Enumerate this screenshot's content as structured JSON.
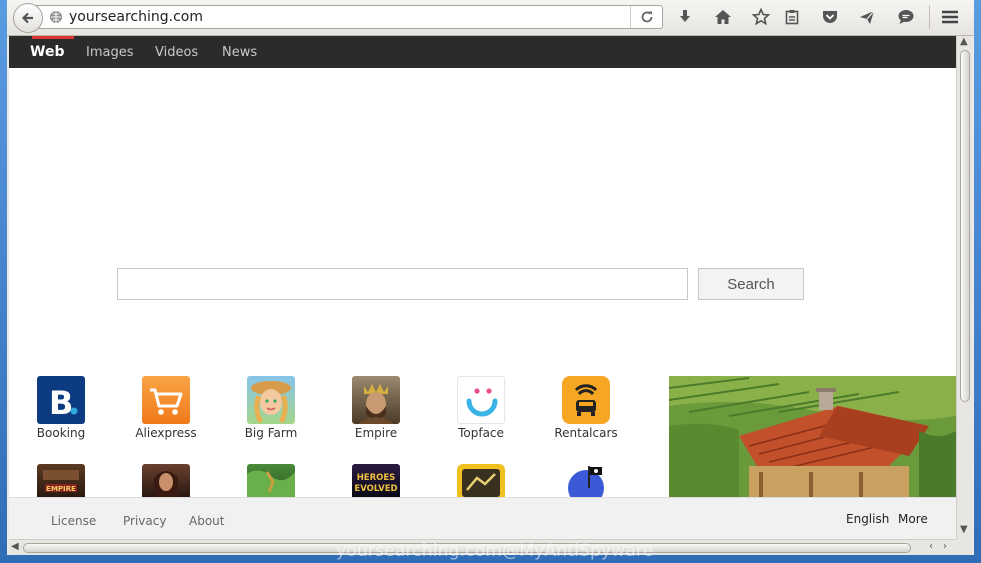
{
  "browser": {
    "url": "yoursearching.com"
  },
  "nav": {
    "items": [
      {
        "label": "Web",
        "active": true
      },
      {
        "label": "Images",
        "active": false
      },
      {
        "label": "Videos",
        "active": false
      },
      {
        "label": "News",
        "active": false
      }
    ]
  },
  "search": {
    "value": "",
    "button_label": "Search"
  },
  "tiles": {
    "row1": [
      {
        "label": "Booking",
        "icon": "booking-icon",
        "color": "#0c3b82"
      },
      {
        "label": "Aliexpress",
        "icon": "shopping-cart-icon",
        "color": "#f58b28"
      },
      {
        "label": "Big Farm",
        "icon": "farm-girl-icon",
        "color": "#e0a860"
      },
      {
        "label": "Empire",
        "icon": "king-icon",
        "color": "#6a5030"
      },
      {
        "label": "Topface",
        "icon": "topface-icon",
        "color": "#ffffff"
      },
      {
        "label": "Rentalcars",
        "icon": "car-icon",
        "color": "#f5a623"
      }
    ],
    "row2": [
      {
        "icon": "empire-game-icon"
      },
      {
        "icon": "warrior-woman-icon"
      },
      {
        "icon": "jungle-game-icon"
      },
      {
        "icon": "heroes-evolved-icon",
        "text": "HEROES EVOLVED"
      },
      {
        "icon": "yellow-game-icon"
      },
      {
        "icon": "pirate-flag-icon"
      }
    ]
  },
  "footer": {
    "license": "License",
    "privacy": "Privacy",
    "about": "About",
    "language": "English",
    "more": "More"
  },
  "watermark": "yoursearching.com@MyAntiSpyware"
}
